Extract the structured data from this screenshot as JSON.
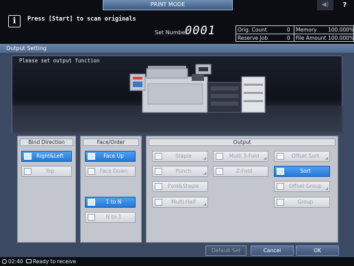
{
  "header": {
    "mode_tab": "PRINT MODE",
    "speaker_icon": "speaker-icon",
    "help_label": "?",
    "info_icon_glyph": "i",
    "instruction": "Press [Start] to scan originals",
    "set_number_label": "Set Number",
    "set_number_value": "0001",
    "counters": {
      "orig_count_label": "Orig. Count",
      "orig_count_value": "0",
      "memory_label": "Memory",
      "memory_value": "100.000%",
      "reserve_job_label": "Reserve Job",
      "reserve_job_value": "0",
      "file_amount_label": "File Amount",
      "file_amount_value": "100.000%"
    }
  },
  "panel": {
    "title": "Output Setting",
    "instruction": "Please set output function"
  },
  "bind_direction": {
    "title": "Bind Direction",
    "right_left": "Right&Left",
    "top": "Top"
  },
  "face_order": {
    "title": "Face/Order",
    "face_up": "Face Up",
    "face_down": "Face Down",
    "one_to_n": "1 to N",
    "n_to_one": "N to 1"
  },
  "output": {
    "title": "Output",
    "staple": "Staple",
    "punch": "Punch",
    "fold_staple": "Fold&Staple",
    "multi_half": "Multi Half",
    "multi_3fold": "Multi 3-Fold",
    "z_fold": "Z-Fold",
    "offset_sort": "Offset Sort",
    "sort": "Sort",
    "offset_group": "Offset Group",
    "group": "Group"
  },
  "footer": {
    "default_set": "Default Set",
    "cancel": "Cancel",
    "ok": "OK"
  },
  "status": {
    "time": "02:40",
    "message": "Ready to receive"
  },
  "colors": {
    "selected": "#2479d6",
    "panel": "#3b4a62",
    "titlebar": "#5a7399"
  }
}
